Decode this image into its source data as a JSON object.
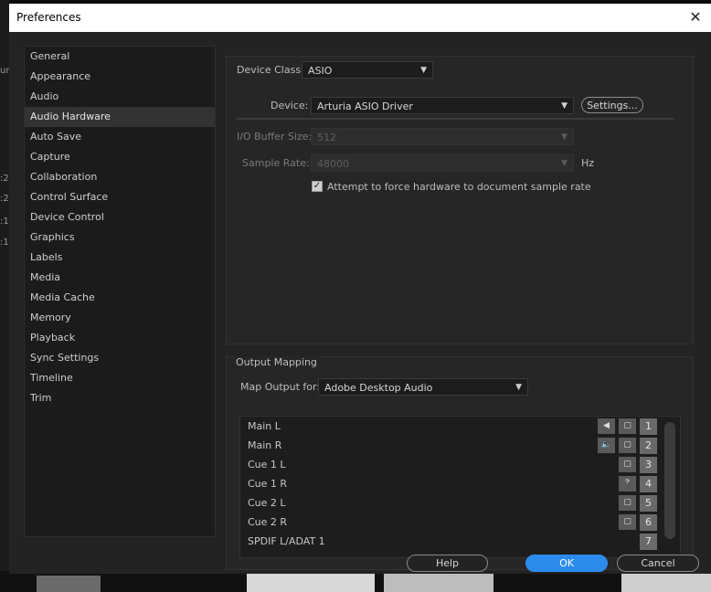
{
  "dialog": {
    "title": "Preferences"
  },
  "sidebar": {
    "items": [
      {
        "label": "General",
        "active": false
      },
      {
        "label": "Appearance",
        "active": false
      },
      {
        "label": "Audio",
        "active": false
      },
      {
        "label": "Audio Hardware",
        "active": true
      },
      {
        "label": "Auto Save",
        "active": false
      },
      {
        "label": "Capture",
        "active": false
      },
      {
        "label": "Collaboration",
        "active": false
      },
      {
        "label": "Control Surface",
        "active": false
      },
      {
        "label": "Device Control",
        "active": false
      },
      {
        "label": "Graphics",
        "active": false
      },
      {
        "label": "Labels",
        "active": false
      },
      {
        "label": "Media",
        "active": false
      },
      {
        "label": "Media Cache",
        "active": false
      },
      {
        "label": "Memory",
        "active": false
      },
      {
        "label": "Playback",
        "active": false
      },
      {
        "label": "Sync Settings",
        "active": false
      },
      {
        "label": "Timeline",
        "active": false
      },
      {
        "label": "Trim",
        "active": false
      }
    ]
  },
  "device_class": {
    "label": "Device Class:",
    "value": "ASIO"
  },
  "device": {
    "label": "Device:",
    "value": "Arturia ASIO Driver",
    "settings_button": "Settings..."
  },
  "buffer": {
    "label": "I/O Buffer Size:",
    "value": "512"
  },
  "sample_rate": {
    "label": "Sample Rate:",
    "value": "48000",
    "unit": "Hz"
  },
  "force_rate": {
    "label": "Attempt to force hardware to document sample rate",
    "checked": true
  },
  "output_mapping": {
    "title": "Output Mapping",
    "map_label": "Map Output for:",
    "map_value": "Adobe Desktop Audio",
    "rows": [
      {
        "label": "Main L",
        "icons": [
          "speaker-left-icon",
          "frame-icon"
        ],
        "channel": "1"
      },
      {
        "label": "Main R",
        "icons": [
          "speaker-right-icon",
          "frame-icon"
        ],
        "channel": "2"
      },
      {
        "label": "Cue 1 L",
        "icons": [
          "frame-icon"
        ],
        "channel": "3"
      },
      {
        "label": "Cue 1 R",
        "icons": [
          "bass-clef-icon"
        ],
        "channel": "4"
      },
      {
        "label": "Cue 2 L",
        "icons": [
          "frame-icon"
        ],
        "channel": "5"
      },
      {
        "label": "Cue 2 R",
        "icons": [
          "frame-icon"
        ],
        "channel": "6"
      },
      {
        "label": "SPDIF L/ADAT 1",
        "icons": [],
        "channel": "7"
      }
    ]
  },
  "footer": {
    "help": "Help",
    "ok": "OK",
    "cancel": "Cancel"
  },
  "background": {
    "fragments": [
      ":2",
      ":2",
      ":1",
      ":1",
      "ur"
    ]
  },
  "colors": {
    "accent": "#2d8ceb",
    "panel": "#262626",
    "sidebar_active": "#333333"
  }
}
